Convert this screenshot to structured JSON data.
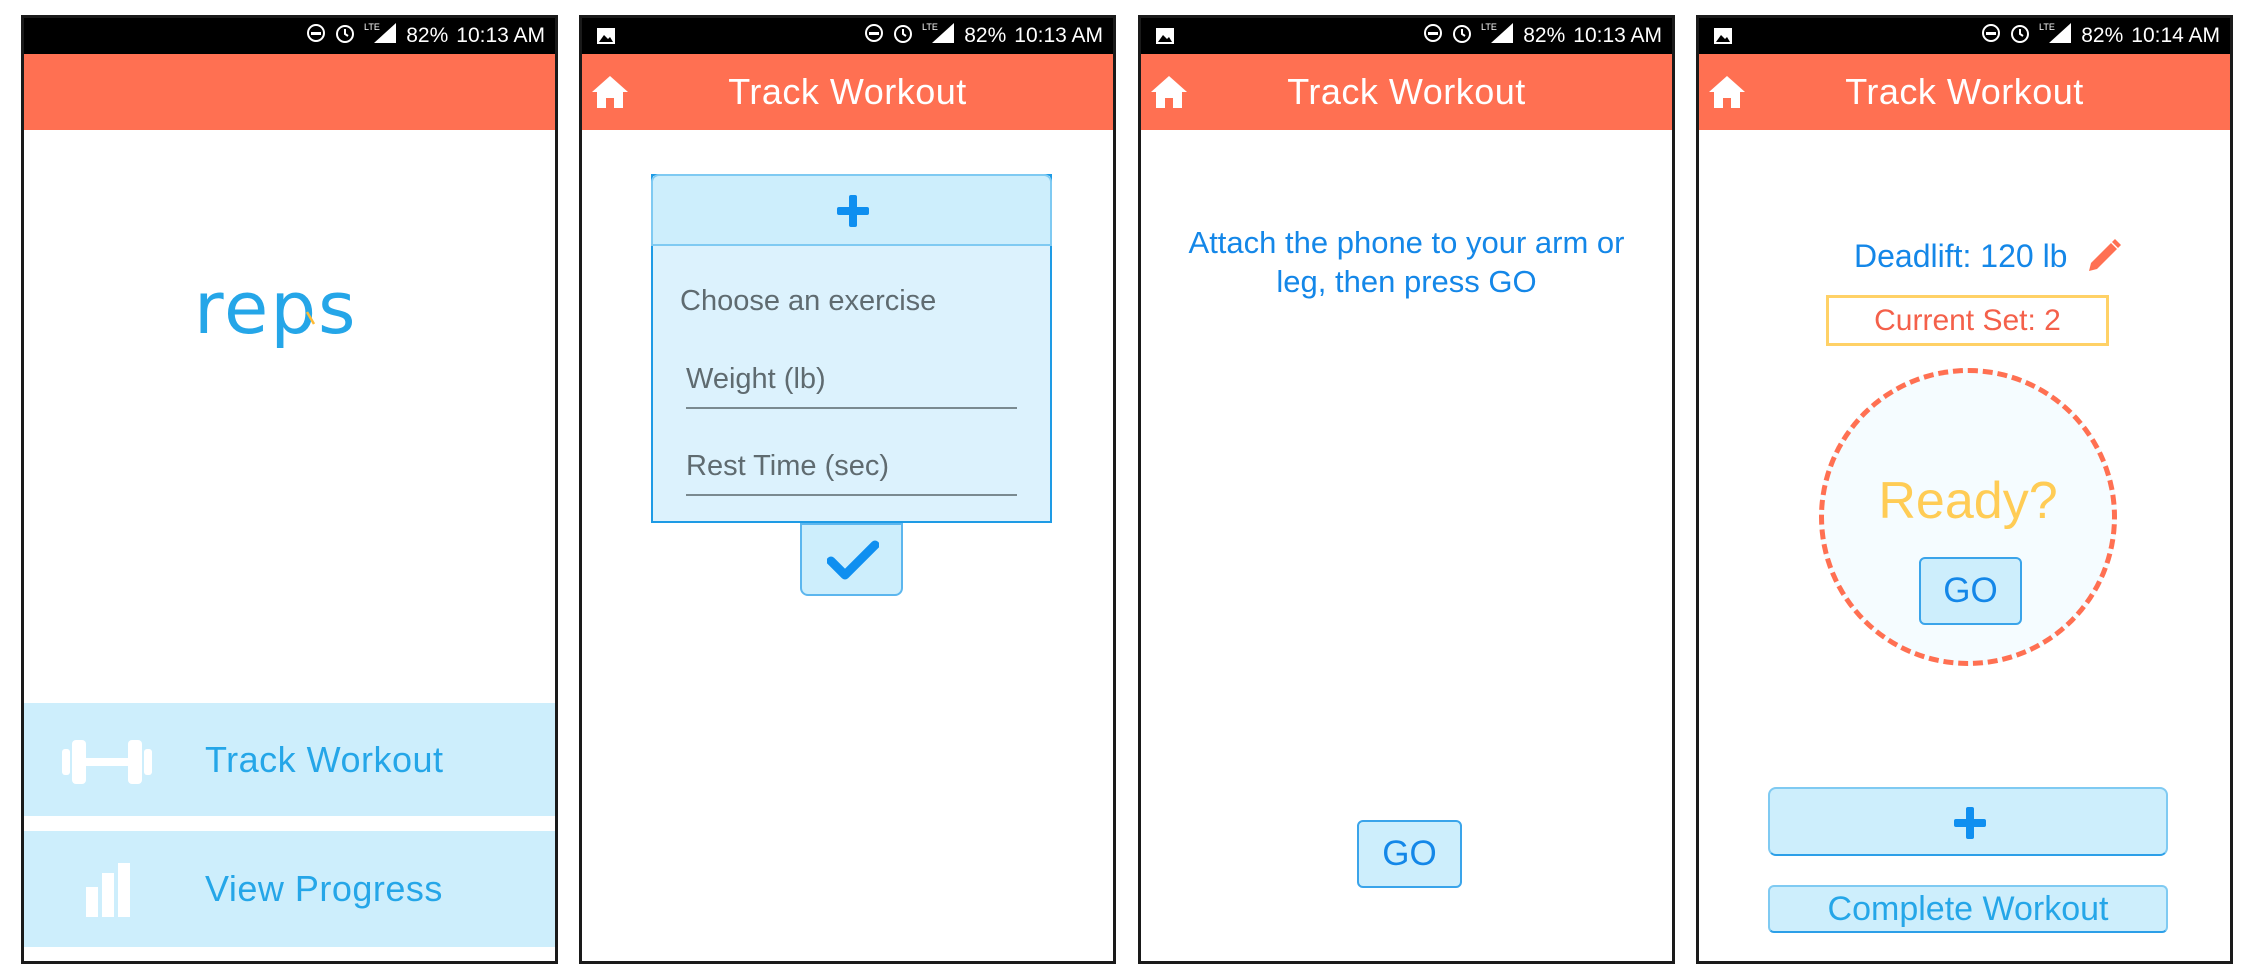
{
  "screens": [
    {
      "status": {
        "battery": "82%",
        "time": "10:13 AM",
        "network": "LTE"
      },
      "logo_text": "reps",
      "nav": [
        {
          "label": "Track Workout",
          "icon": "dumbbell-icon"
        },
        {
          "label": "View Progress",
          "icon": "bar-chart-icon"
        }
      ]
    },
    {
      "status": {
        "battery": "82%",
        "time": "10:13 AM",
        "network": "LTE"
      },
      "title": "Track Workout",
      "form": {
        "exercise_label": "Choose an exercise",
        "weight_placeholder": "Weight (lb)",
        "rest_placeholder": "Rest Time (sec)"
      }
    },
    {
      "status": {
        "battery": "82%",
        "time": "10:13 AM",
        "network": "LTE"
      },
      "title": "Track Workout",
      "instruction": "Attach the phone to your arm or leg, then press GO",
      "go_label": "GO"
    },
    {
      "status": {
        "battery": "82%",
        "time": "10:14 AM",
        "network": "LTE"
      },
      "title": "Track Workout",
      "exercise": "Deadlift: 120 lb",
      "current_set": "Current Set: 2",
      "ready": "Ready?",
      "go_label": "GO",
      "complete_label": "Complete Workout"
    }
  ],
  "colors": {
    "appbar": "#ff7052",
    "button_fill": "#cdeefc",
    "primary_text": "#1487e8",
    "ready": "#ffcc55",
    "set_border": "#ffd166"
  }
}
